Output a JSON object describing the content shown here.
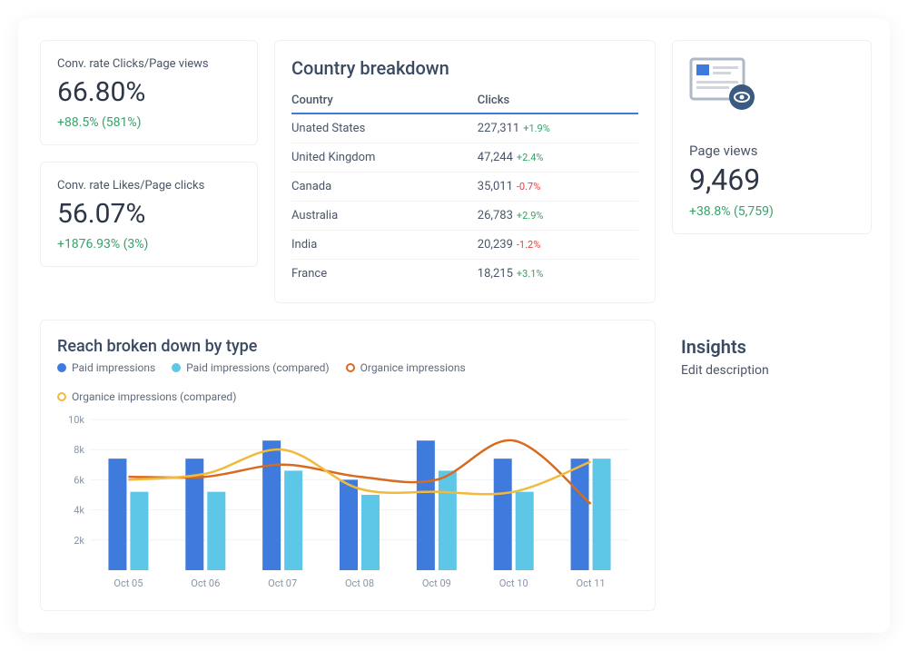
{
  "metrics": {
    "conv_clicks": {
      "label": "Conv. rate Clicks/Page views",
      "value": "66.80%",
      "delta": "+88.5% (581%)"
    },
    "conv_likes": {
      "label": "Conv. rate Likes/Page clicks",
      "value": "56.07%",
      "delta": "+1876.93% (3%)"
    }
  },
  "country_breakdown": {
    "title": "Country breakdown",
    "headers": {
      "country": "Country",
      "clicks": "Clicks"
    },
    "rows": [
      {
        "country": "Unated States",
        "clicks": "227,311",
        "pct": "+1.9%",
        "dir": "up"
      },
      {
        "country": "United Kingdom",
        "clicks": "47,244",
        "pct": "+2.4%",
        "dir": "up"
      },
      {
        "country": "Canada",
        "clicks": "35,011",
        "pct": "-0.7%",
        "dir": "down"
      },
      {
        "country": "Australia",
        "clicks": "26,783",
        "pct": "+2.9%",
        "dir": "up"
      },
      {
        "country": "India",
        "clicks": "20,239",
        "pct": "-1.2%",
        "dir": "down"
      },
      {
        "country": "France",
        "clicks": "18,215",
        "pct": "+3.1%",
        "dir": "up"
      }
    ]
  },
  "page_views": {
    "label": "Page views",
    "value": "9,469",
    "delta": "+38.8% (5,759)"
  },
  "reach_chart": {
    "title": "Reach broken down by type",
    "legend": {
      "paid": "Paid impressions",
      "paid_cmp": "Paid impressions (compared)",
      "organic": "Organice impressions",
      "organic_cmp": "Organice impressions (compared)"
    },
    "y_ticks": [
      "10k",
      "8k",
      "6k",
      "4k",
      "2k"
    ]
  },
  "insights": {
    "title": "Insights",
    "subtitle": "Edit description"
  },
  "chart_data": {
    "type": "bar",
    "title": "Reach broken down by type",
    "xlabel": "",
    "ylabel": "",
    "ylim": [
      0,
      10000
    ],
    "categories": [
      "Oct 05",
      "Oct 06",
      "Oct 07",
      "Oct 08",
      "Oct 09",
      "Oct 10",
      "Oct 11"
    ],
    "series": [
      {
        "name": "Paid impressions",
        "type": "bar",
        "color": "#3f7bdc",
        "values": [
          7400,
          7400,
          8600,
          6000,
          8600,
          7400,
          7400
        ]
      },
      {
        "name": "Paid impressions (compared)",
        "type": "bar",
        "color": "#5ec6e6",
        "values": [
          5200,
          5200,
          6600,
          5000,
          6600,
          5200,
          7400
        ]
      },
      {
        "name": "Organice impressions",
        "type": "line",
        "color": "#d86b1f",
        "values": [
          6200,
          6200,
          7000,
          6200,
          6000,
          8600,
          4400
        ]
      },
      {
        "name": "Organice impressions (compared)",
        "type": "line",
        "color": "#f2b93b",
        "values": [
          6000,
          6400,
          8000,
          5400,
          5200,
          5200,
          7200
        ]
      }
    ]
  }
}
